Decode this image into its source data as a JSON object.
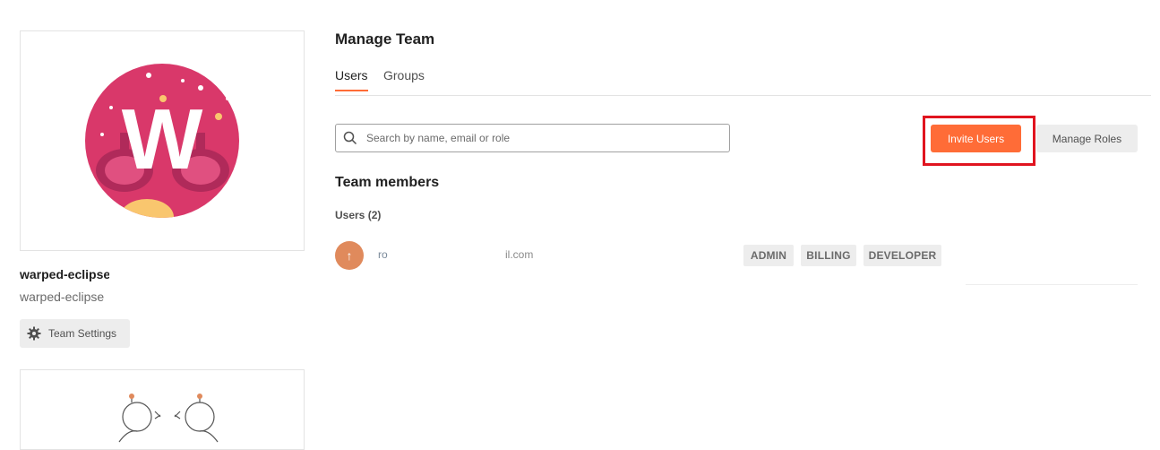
{
  "team": {
    "name": "warped-eclipse",
    "domain": "warped-eclipse",
    "avatar_letter": "W",
    "settings_label": "Team Settings"
  },
  "main": {
    "title": "Manage Team",
    "tabs": [
      {
        "label": "Users",
        "active": true
      },
      {
        "label": "Groups",
        "active": false
      }
    ],
    "search": {
      "placeholder": "Search by name, email or role",
      "value": ""
    },
    "invite_label": "Invite Users",
    "manage_roles_label": "Manage Roles",
    "members_heading": "Team members",
    "users_count_label": "Users (2)",
    "members": [
      {
        "email_start": "ro",
        "email_end": "il.com",
        "avatar_glyph": "↑",
        "roles": [
          "ADMIN",
          "BILLING",
          "DEVELOPER"
        ]
      }
    ]
  },
  "colors": {
    "accent": "#ff6c37",
    "highlight": "#e0141f",
    "avatar_bg": "#d9386a"
  }
}
